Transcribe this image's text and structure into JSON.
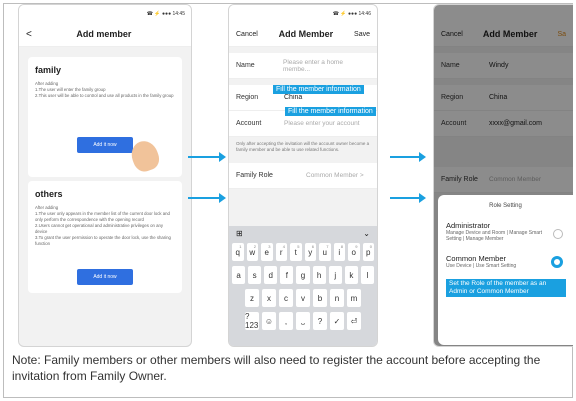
{
  "colors": {
    "accent": "#2f6fe0",
    "callout": "#1aa0e0",
    "save": "#e08a1a"
  },
  "phone1": {
    "status": "☎ ⚡ ●●● 14:45",
    "back": "<",
    "title": "Add member",
    "family": {
      "title": "family",
      "line1": "After adding",
      "line2": "1.The user will enter the family group",
      "line3": "2.This user will be able to control and use all products in the family group",
      "button": "Add it now"
    },
    "others": {
      "title": "others",
      "line1": "After adding",
      "line2": "1.The user only appears in the member list of the current door lock and only perform the correspondence with the opening record",
      "line3": "2.Users cannot get operational and administrative privileges on any device",
      "line4": "3.To grant the user permission to operate the door lock, use the sharing function",
      "button": "Add it now"
    }
  },
  "phone2": {
    "status": "☎ ⚡ ●●● 14:46",
    "cancel": "Cancel",
    "title": "Add Member",
    "save": "Save",
    "name_label": "Name",
    "name_placeholder": "Please enter a home membe...",
    "region_label": "Region",
    "region_value": "China",
    "account_label": "Account",
    "account_placeholder": "Please enter your account",
    "tip1": "Fill the member information",
    "tip2": "Fill the member information",
    "info": "Only after accepting the invitation will the account owner become a family member and be able to use related functions.",
    "role_label": "Family Role",
    "role_value": "Common Member >",
    "keyboard": {
      "row1": [
        "q",
        "w",
        "e",
        "r",
        "t",
        "y",
        "u",
        "i",
        "o",
        "p"
      ],
      "row1_sup": [
        "1",
        "2",
        "3",
        "4",
        "5",
        "6",
        "7",
        "8",
        "9",
        "0"
      ],
      "row2": [
        "a",
        "s",
        "d",
        "f",
        "g",
        "h",
        "j",
        "k",
        "l"
      ],
      "row3": [
        "z",
        "x",
        "c",
        "v",
        "b",
        "n",
        "m"
      ],
      "row4": [
        "?123",
        "☺",
        ",",
        "⎵",
        "?",
        "✓",
        "⏎"
      ]
    }
  },
  "phone3": {
    "cancel": "Cancel",
    "title": "Add Member",
    "save": "Sa",
    "name_label": "Name",
    "name_value": "Windy",
    "region_label": "Region",
    "region_value": "China",
    "account_label": "Account",
    "account_value": "xxxx@gmail.com",
    "role_label": "Family Role",
    "role_value": "Common Member",
    "modal_title": "Role Setting",
    "admin_title": "Administrator",
    "admin_desc": "Manage Device and Room | Manage Smart Setting | Manage Member",
    "common_title": "Common Member",
    "common_desc": "Use Device | Use Smart Setting",
    "tip": "Set the Role of the member as an Admin or Common Member"
  },
  "note": "Note: Family members or other members will also need to register the account before accepting the invitation from Family Owner."
}
